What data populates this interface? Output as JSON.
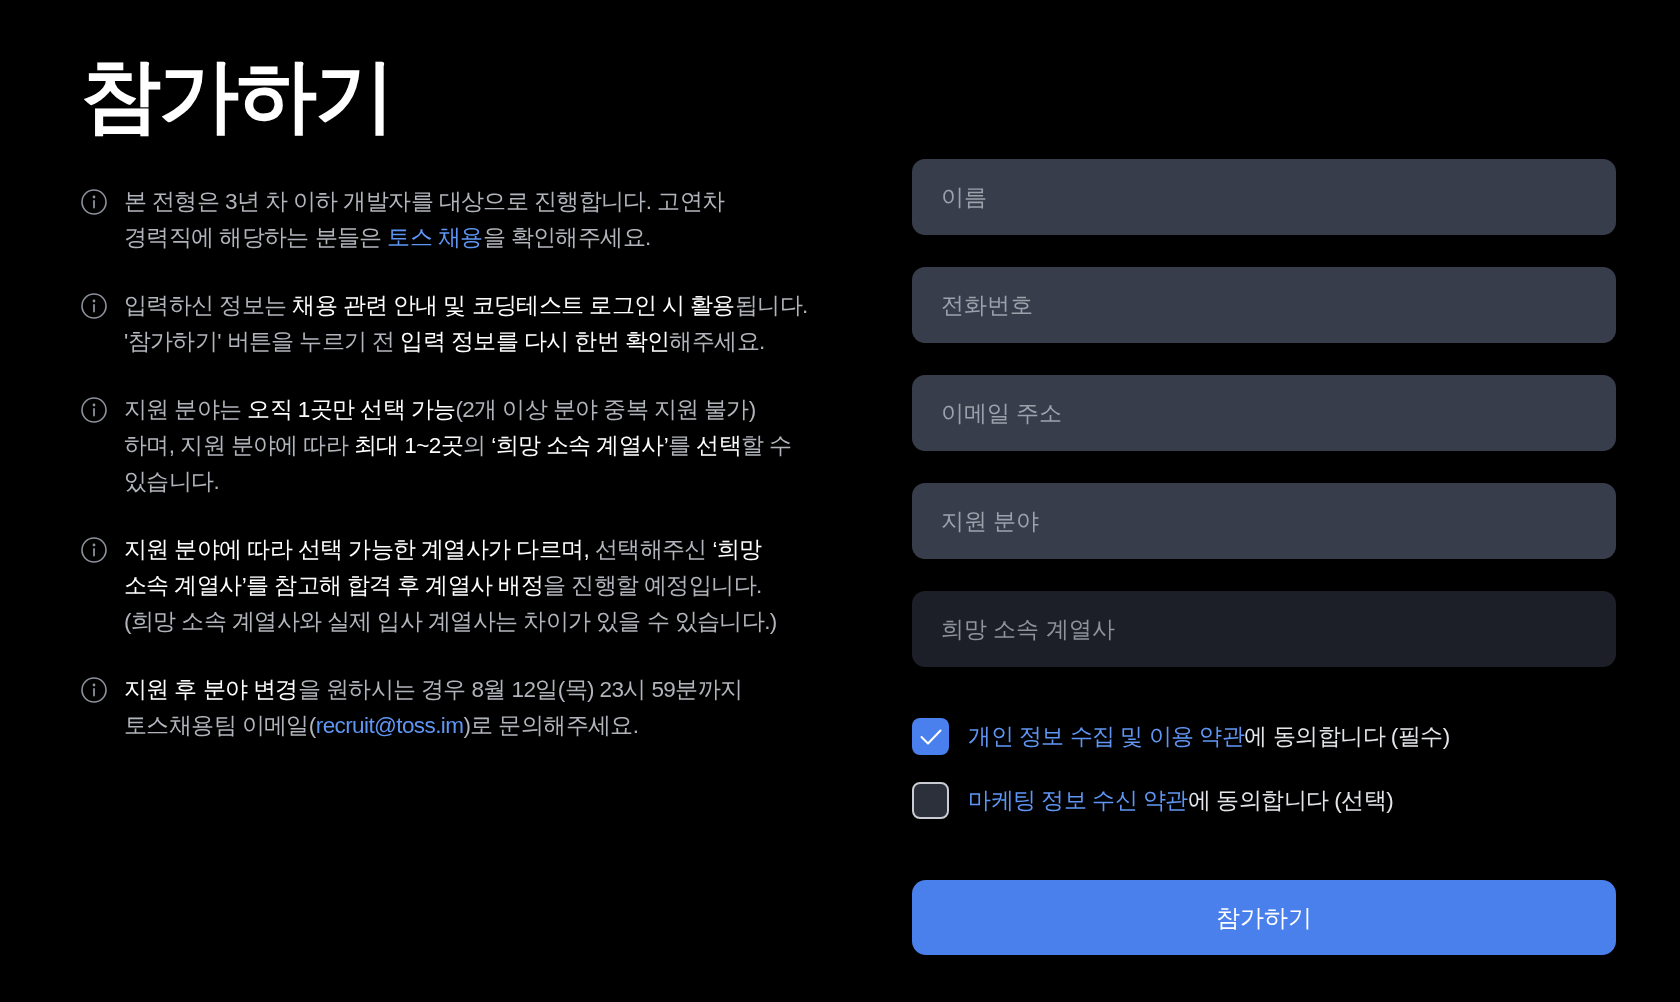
{
  "title": "참가하기",
  "notices": [
    {
      "segments": [
        {
          "kind": "plain",
          "text": "본 전형은 3년 차 이하 개발자를 대상으로 진행합니다. 고연차 경력직에 해당하는 분들은 "
        },
        {
          "kind": "link",
          "text": "토스 채용"
        },
        {
          "kind": "plain",
          "text": "을 확인해주세요."
        }
      ]
    },
    {
      "segments": [
        {
          "kind": "plain",
          "text": "입력하신 정보는 "
        },
        {
          "kind": "strong",
          "text": "채용 관련 안내 및 코딩테스트 로그인 시 활용"
        },
        {
          "kind": "plain",
          "text": "됩니다. '참가하기' 버튼을 누르기 전 "
        },
        {
          "kind": "strong",
          "text": "입력 정보를 다시 한번 확인"
        },
        {
          "kind": "plain",
          "text": "해주세요."
        }
      ]
    },
    {
      "segments": [
        {
          "kind": "plain",
          "text": "지원 분야는 "
        },
        {
          "kind": "strong",
          "text": "오직 1곳만 선택 가능"
        },
        {
          "kind": "plain",
          "text": "(2개 이상 분야 중복 지원 불가) 하며, 지원 분야에 따라 "
        },
        {
          "kind": "strong",
          "text": "최대 1~2곳"
        },
        {
          "kind": "plain",
          "text": "의 "
        },
        {
          "kind": "strong",
          "text": "‘희망 소속 계열사’"
        },
        {
          "kind": "plain",
          "text": "를 "
        },
        {
          "kind": "strong",
          "text": "선택"
        },
        {
          "kind": "plain",
          "text": "할 수 있습니다."
        }
      ]
    },
    {
      "segments": [
        {
          "kind": "strong",
          "text": "지원 분야에 따라 선택 가능한 계열사가 다르며,"
        },
        {
          "kind": "plain",
          "text": " 선택해주신 "
        },
        {
          "kind": "strong",
          "text": "‘희망 소속 계열사’를 참고해 합격 후 계열사 배정"
        },
        {
          "kind": "plain",
          "text": "을 진행할 예정입니다. (희망 소속 계열사와 실제 입사 계열사는 차이가 있을 수 있습니다.)"
        }
      ]
    },
    {
      "segments": [
        {
          "kind": "strong",
          "text": "지원 후 분야 변경"
        },
        {
          "kind": "plain",
          "text": "을 원하시는 경우 8월 12일(목) 23시 59분까지 토스채용팀 이메일("
        },
        {
          "kind": "link",
          "text": "recruit@toss.im"
        },
        {
          "kind": "plain",
          "text": ")로 문의해주세요."
        }
      ]
    }
  ],
  "fields": [
    {
      "placeholder": "이름",
      "disabled": false
    },
    {
      "placeholder": "전화번호",
      "disabled": false
    },
    {
      "placeholder": "이메일 주소",
      "disabled": false
    },
    {
      "placeholder": "지원 분야",
      "disabled": false
    },
    {
      "placeholder": "희망 소속 계열사",
      "disabled": true
    }
  ],
  "consents": [
    {
      "checked": true,
      "segments": [
        {
          "kind": "link",
          "text": "개인 정보 수집 및 이용 약관"
        },
        {
          "kind": "plain",
          "text": "에 동의합니다 (필수)"
        }
      ]
    },
    {
      "checked": false,
      "segments": [
        {
          "kind": "link",
          "text": "마케팅 정보 수신 약관"
        },
        {
          "kind": "plain",
          "text": "에 동의합니다 (선택)"
        }
      ]
    }
  ],
  "submit_button": {
    "label": "참가하기"
  }
}
